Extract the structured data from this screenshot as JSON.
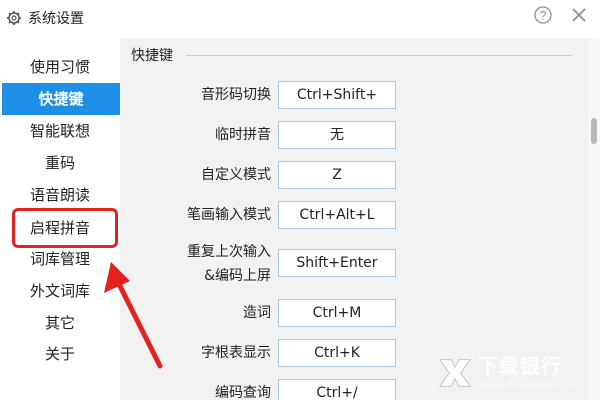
{
  "window": {
    "title": "系统设置",
    "icons": {
      "app": "gear-icon",
      "help": "help-icon",
      "close": "close-icon"
    }
  },
  "sidebar": {
    "items": [
      {
        "label": "使用习惯",
        "active": false
      },
      {
        "label": "快捷键",
        "active": true
      },
      {
        "label": "智能联想",
        "active": false
      },
      {
        "label": "重码",
        "active": false
      },
      {
        "label": "语音朗读",
        "active": false
      },
      {
        "label": "启程拼音",
        "active": false
      },
      {
        "label": "词库管理",
        "active": false
      },
      {
        "label": "外文词库",
        "active": false
      },
      {
        "label": "其它",
        "active": false
      },
      {
        "label": "关于",
        "active": false
      }
    ]
  },
  "main": {
    "section_title": "快捷键",
    "shortcuts": [
      {
        "label": "音形码切换",
        "value": "Ctrl+Shift+"
      },
      {
        "label": "临时拼音",
        "value": "无"
      },
      {
        "label": "自定义模式",
        "value": "Z"
      },
      {
        "label": "笔画输入模式",
        "value": "Ctrl+Alt+L"
      },
      {
        "label": "重复上次输入",
        "label_line2": "&编码上屏",
        "value": "Shift+Enter"
      },
      {
        "label": "造词",
        "value": "Ctrl+M"
      },
      {
        "label": "字根表显示",
        "value": "Ctrl+K"
      },
      {
        "label": "编码查询",
        "value": "Ctrl+/"
      }
    ]
  },
  "watermark": {
    "text": "下载银行",
    "sub": "www.downbank.cn"
  },
  "colors": {
    "accent": "#1e8fe6",
    "highlight": "#e0231f",
    "content_bg": "#f2f2f2",
    "key_border": "#a9c7e0"
  }
}
